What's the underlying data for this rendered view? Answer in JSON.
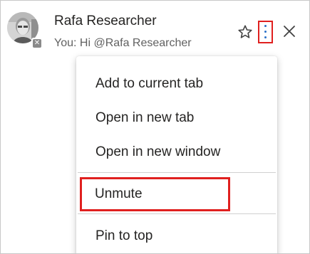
{
  "chat": {
    "name": "Rafa Researcher",
    "preview": "You: Hi @Rafa Researcher",
    "presence_glyph": "✕"
  },
  "icons": {
    "favorite": "star-icon",
    "more": "more-options-icon",
    "close": "close-icon",
    "status": "presence-icon"
  },
  "menu": {
    "items": [
      {
        "label": "Add to current tab"
      },
      {
        "label": "Open in new tab"
      },
      {
        "label": "Open in new window"
      },
      {
        "label": "Unmute"
      },
      {
        "label": "Pin to top"
      }
    ]
  },
  "colors": {
    "highlight": "#e0201f",
    "accent": "#2a71c9",
    "text": "#252423",
    "muted_text": "#616161"
  }
}
